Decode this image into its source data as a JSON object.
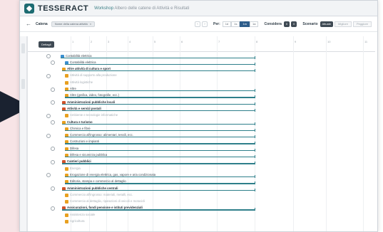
{
  "app": {
    "brand": "TESSERACT",
    "title_prefix": "Workshop",
    "title_rest": "Albero delle catene di Attività e Risultati"
  },
  "toolbar": {
    "back_icon": "arrow-left-icon",
    "catena_label": "Catena",
    "catena_value": "Nome della catena attività",
    "prev_icon": "chevron-left-icon",
    "next_icon": "chevron-right-icon",
    "per_label": "Per:",
    "per_options": [
      "1d",
      "1s",
      "1m",
      "1a"
    ],
    "per_selected": "1m",
    "considera_label": "Considera",
    "considera_from": "0",
    "considera_to": "0",
    "scenario_label": "Scenario",
    "scenario_options": [
      "Attuale",
      "Migliore",
      "Peggiore"
    ],
    "scenario_selected": "Attuale"
  },
  "grid": {
    "details_button": "Dettagli",
    "column_numbers": [
      "1",
      "2",
      "3",
      "4",
      "5",
      "6",
      "7",
      "8",
      "9",
      "10",
      "11"
    ],
    "rows": [
      {
        "label": "Contabilità elettrica",
        "style": "normal",
        "bar": true,
        "icon_color": "#3b8fd0"
      },
      {
        "label": "Contabilità elettrica",
        "style": "normal",
        "bar": true,
        "icon_color": "#3b8fd0"
      },
      {
        "label": "Altre attività di cultura e sport",
        "style": "strong",
        "bar": true,
        "icon_color": "#e8a020"
      },
      {
        "label": "Attività di supporto alla produzione",
        "style": "dim",
        "bar": false,
        "icon_color": "#e8a020"
      },
      {
        "label": "Attività logistiche",
        "style": "dim",
        "bar": false,
        "icon_color": "#e8a020"
      },
      {
        "label": "Altre",
        "style": "normal",
        "bar": true,
        "icon_color": "#e8a020"
      },
      {
        "label": "Altre (grafica, video, fotografie, ecc.)",
        "style": "normal",
        "bar": true,
        "icon_color": "#e8a020"
      },
      {
        "label": "Amministrazioni pubbliche locali",
        "style": "strong",
        "bar": true,
        "icon_color": "#d0532b"
      },
      {
        "label": "Attività e servizi postali",
        "style": "strong",
        "bar": true,
        "icon_color": "#d0532b"
      },
      {
        "label": "Ambiente e tecnologie informatiche",
        "style": "dim",
        "bar": false,
        "icon_color": "#e8a020"
      },
      {
        "label": "Cultura e turismo",
        "style": "strong",
        "bar": true,
        "icon_color": "#e8a020"
      },
      {
        "label": "Chimica e fibre",
        "style": "normal",
        "bar": true,
        "icon_color": "#e8a020"
      },
      {
        "label": "Commercio all'ingrosso: alimentari, tessili, ecc.",
        "style": "normal",
        "bar": true,
        "icon_color": "#e8a020"
      },
      {
        "label": "Costruzioni e impianti",
        "style": "normal",
        "bar": true,
        "icon_color": "#e8a020"
      },
      {
        "label": "Difesa",
        "style": "normal",
        "bar": true,
        "icon_color": "#e8a020"
      },
      {
        "label": "Difesa e sicurezza pubblica",
        "style": "normal",
        "bar": true,
        "icon_color": "#e8a020"
      },
      {
        "label": "Cantieri pubblici",
        "style": "strong",
        "bar": true,
        "icon_color": "#d0532b"
      },
      {
        "label": "Energia",
        "style": "dim",
        "bar": false,
        "icon_color": "#e8a020"
      },
      {
        "label": "Erogazione di energia elettrica, gas, vapore e aria condizionata",
        "style": "normal",
        "bar": true,
        "icon_color": "#e8a020"
      },
      {
        "label": "Editoria, stampa e commercio al dettaglio",
        "style": "normal",
        "bar": true,
        "icon_color": "#e8a020"
      },
      {
        "label": "Amministrazioni pubbliche centrali",
        "style": "strong",
        "bar": true,
        "icon_color": "#d0532b"
      },
      {
        "label": "Commercio all'ingrosso: materiali, metalli, ecc.",
        "style": "dim",
        "bar": false,
        "icon_color": "#e8a020"
      },
      {
        "label": "Commercio al dettaglio, riparazioni di veicoli e motocicli",
        "style": "dim",
        "bar": false,
        "icon_color": "#e8a020"
      },
      {
        "label": "Assicurazioni, fondi pensione e istituti previdenziali",
        "style": "strong",
        "bar": true,
        "icon_color": "#d0532b"
      },
      {
        "label": "Assistenza sociale",
        "style": "dim",
        "bar": false,
        "icon_color": "#e8a020"
      },
      {
        "label": "Agricoltura",
        "style": "dim",
        "bar": false,
        "icon_color": "#e8a020"
      }
    ]
  }
}
